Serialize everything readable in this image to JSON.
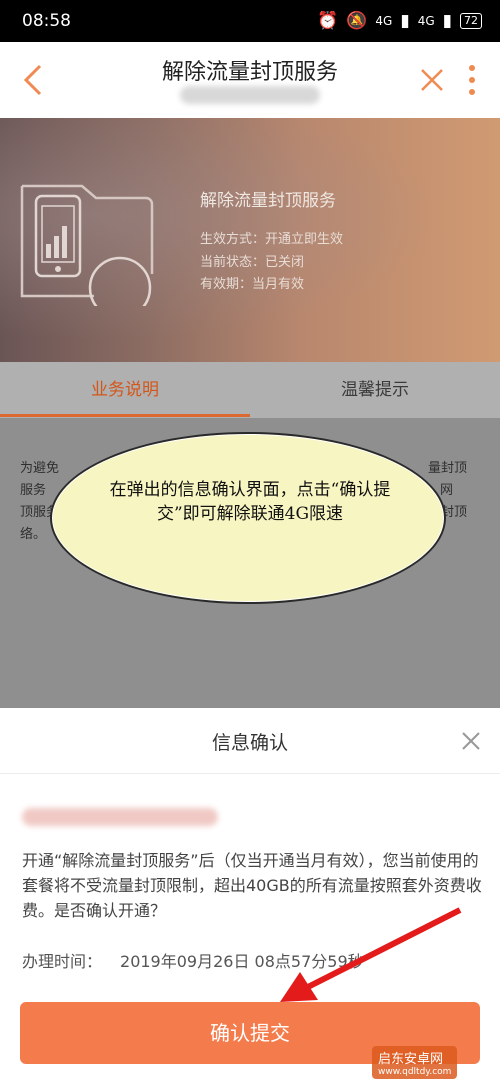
{
  "status": {
    "time": "08:58",
    "sig1": "4G",
    "sig2": "4G",
    "battery": "72"
  },
  "header": {
    "title": "解除流量封顶服务"
  },
  "banner": {
    "service": "解除流量封顶服务",
    "effect": "生效方式：开通立即生效",
    "state": "当前状态：已关闭",
    "validity": "有效期：当月有效"
  },
  "tabs": {
    "desc": "业务说明",
    "tips": "温馨提示"
  },
  "content": {
    "line1": "为避免",
    "line2": "服务",
    "line3": "顶服务",
    "right1": "量封顶",
    "right2": "网",
    "right3": "络。",
    "right4": "量封顶"
  },
  "annotation": {
    "text": "在弹出的信息确认界面，点击“确认提交”即可解除联通4G限速"
  },
  "sheet": {
    "title": "信息确认",
    "desc": "开通“解除流量封顶服务”后（仅当开通当月有效），您当前使用的套餐将不受流量封顶限制，超出40GB的所有流量按照套外资费收费。是否确认开通？",
    "time_label": "办理时间：",
    "time_value": "2019年09月26日 08点57分59秒",
    "confirm": "确认提交"
  },
  "watermark": {
    "name": "启东安卓网",
    "url": "www.qdltdy.com"
  },
  "colors": {
    "accent": "#f47c4c",
    "tab_active": "#d3561a",
    "bubble": "#f7f5c2"
  }
}
